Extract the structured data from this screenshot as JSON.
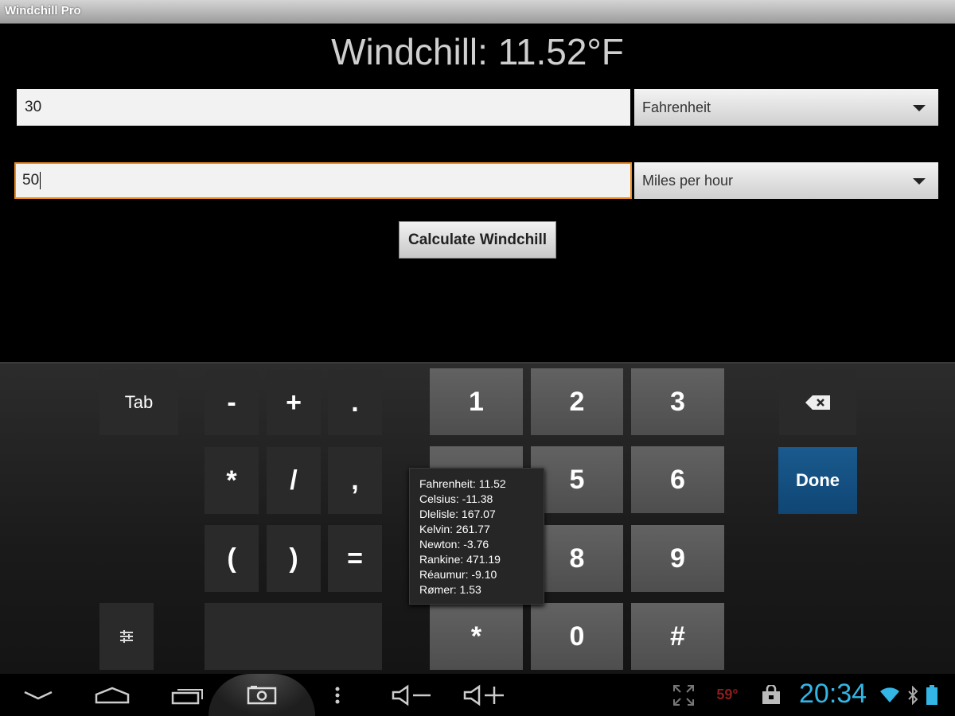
{
  "window": {
    "title": "Windchill Pro"
  },
  "result": {
    "text": "Windchill: 11.52°F"
  },
  "temperature": {
    "value": "30",
    "unit": "Fahrenheit"
  },
  "wind": {
    "value": "50",
    "unit": "Miles per hour"
  },
  "calculate_button": {
    "label": "Calculate Windchill"
  },
  "keyboard": {
    "tab": "Tab",
    "minus": "-",
    "plus": "+",
    "dot": ".",
    "star": "*",
    "slash": "/",
    "comma": ",",
    "lparen": "(",
    "rparen": ")",
    "equals": "=",
    "k1": "1",
    "k2": "2",
    "k3": "3",
    "k5": "5",
    "k6": "6",
    "k8": "8",
    "k9": "9",
    "kstar": "*",
    "k0": "0",
    "khash": "#",
    "done": "Done"
  },
  "popup": {
    "lines": [
      "Fahrenheit: 11.52",
      "Celsius: -11.38",
      "Dlelisle: 167.07",
      "Kelvin: 261.77",
      "Newton: -3.76",
      "Rankine: 471.19",
      "Réaumur: -9.10",
      "Rømer: 1.53"
    ]
  },
  "statusbar": {
    "temp_badge": "59°",
    "time": "20:34"
  },
  "colors": {
    "accent": "#33b5e5",
    "focus": "#f08c1e",
    "done_key": "#0f4674"
  },
  "icons": [
    "back-icon",
    "home-icon",
    "recent-apps-icon",
    "screenshot-icon",
    "menu-icon",
    "volume-down-icon",
    "volume-up-icon",
    "fullscreen-icon",
    "shopping-bag-icon",
    "wifi-icon",
    "bluetooth-icon",
    "battery-icon",
    "backspace-icon",
    "settings-icon"
  ]
}
